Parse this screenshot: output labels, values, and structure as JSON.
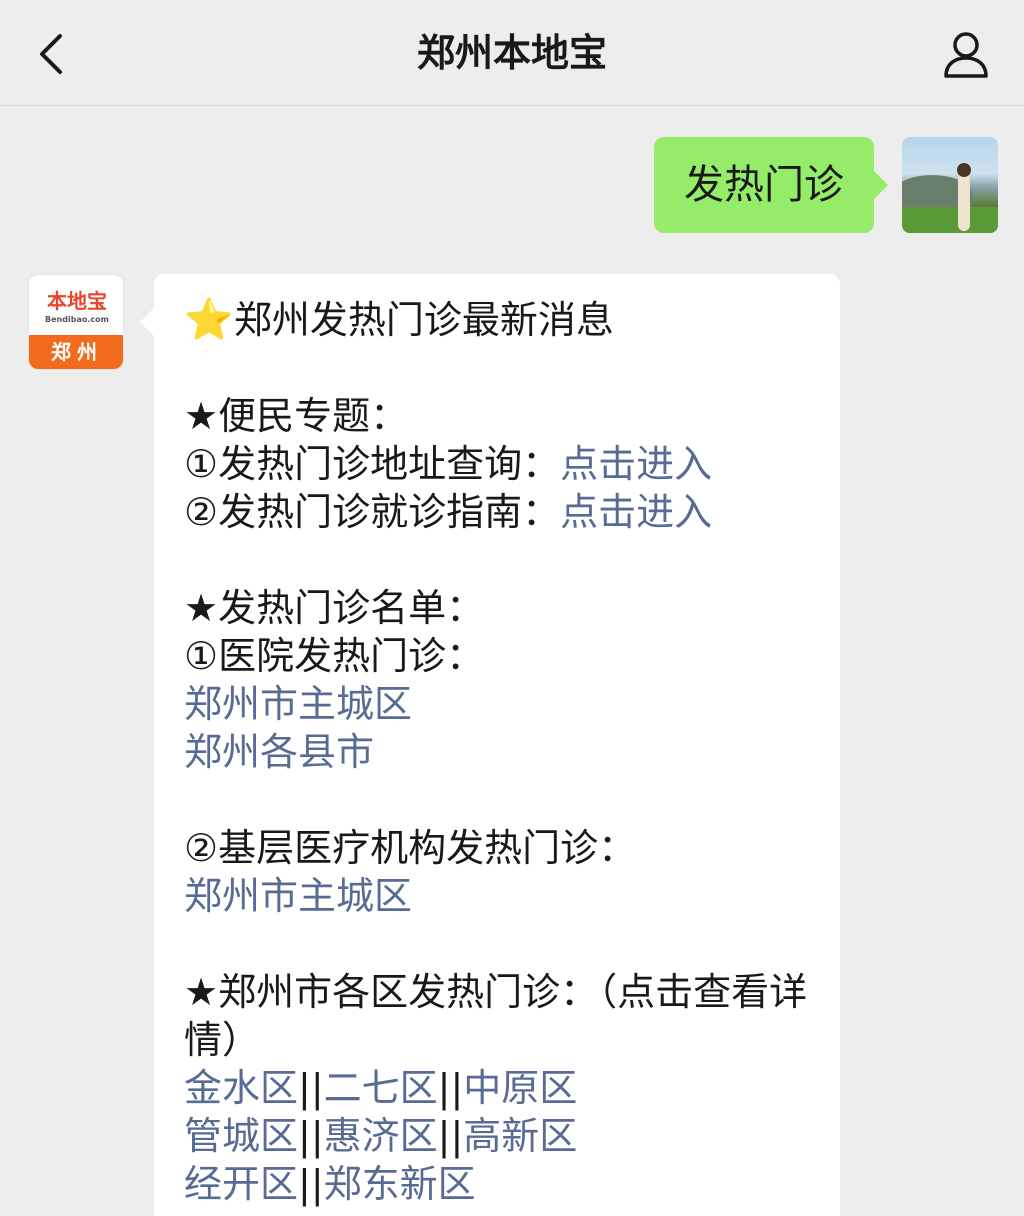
{
  "header": {
    "title": "郑州本地宝"
  },
  "outgoing": {
    "text": "发热门诊"
  },
  "bot_avatar": {
    "logo_main": "本地宝",
    "logo_url": "Bendibao.com",
    "logo_city": "郑州"
  },
  "message": {
    "title_icon": "star-emoji",
    "title": "郑州发热门诊最新消息",
    "sec1_heading": "★便民专题：",
    "sec1_item1_label": "①发热门诊地址查询：",
    "sec1_item1_link": "点击进入",
    "sec1_item2_label": "②发热门诊就诊指南：",
    "sec1_item2_link": "点击进入",
    "sec2_heading": "★发热门诊名单：",
    "sec2_sub1": "①医院发热门诊：",
    "sec2_sub1_link1": "郑州市主城区",
    "sec2_sub1_link2": "郑州各县市",
    "sec2_sub2": "②基层医疗机构发热门诊：",
    "sec2_sub2_link1": "郑州市主城区",
    "sec3_heading": "★郑州市各区发热门诊：（点击查看详情）",
    "districts": [
      "金水区",
      "二七区",
      "中原区",
      "管城区",
      "惠济区",
      "高新区",
      "经开区",
      "郑东新区"
    ],
    "separator": "||"
  }
}
